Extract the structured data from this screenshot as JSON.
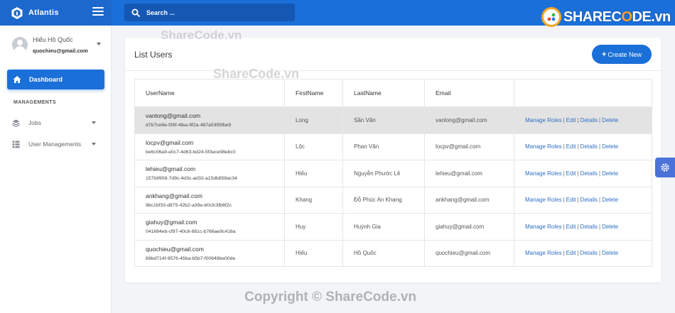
{
  "header": {
    "brand_name": "Atlantis",
    "search_placeholder": "Search ..."
  },
  "watermark": {
    "logo_text_a": "SHAREC",
    "logo_text_o": "O",
    "logo_text_b": "DE.vn",
    "text_1": "ShareCode.vn",
    "text_2": "ShareCode.vn",
    "copyright": "Copyright © ShareCode.vn"
  },
  "sidebar": {
    "user": {
      "name": "Hiếu Hồ Quốc",
      "email": "quochieu@gmail.com"
    },
    "dashboard_label": "Dashboard",
    "section_title": "MANAGEMENTS",
    "items": [
      {
        "label": "Jobs",
        "icon": "layers-icon"
      },
      {
        "label": "User Managements",
        "icon": "table-icon"
      }
    ]
  },
  "main": {
    "title": "List Users",
    "create_button": "Create New",
    "columns": [
      "UserName",
      "FirstName",
      "LastName",
      "Email",
      ""
    ],
    "action_labels": [
      "Manage Roles",
      "Edit",
      "Details",
      "Delete"
    ],
    "rows": [
      {
        "username": "vanlong@gmail.com",
        "id": "d7b7ce9e-f39f-4fea-9f2a-487a5355fbe9",
        "firstname": "Long",
        "lastname": "Sần Văn",
        "email": "vanlong@gmail.com"
      },
      {
        "username": "locpv@gmail.com",
        "id": "be6c06a9-e0c7-4d63-bd24-5f3ece98ebc0",
        "firstname": "Lộc",
        "lastname": "Phan Văn",
        "email": "locpv@gmail.com"
      },
      {
        "username": "lehieu@gmail.com",
        "id": "157b9908-7d9c-4d3c-ad32-a15db858ac34",
        "firstname": "Hiếu",
        "lastname": "Nguyễn Phước Lê",
        "email": "lehieu@gmail.com"
      },
      {
        "username": "ankhang@gmail.com",
        "id": "9bc1bf33-d875-42b2-a39e-b0cfc3fb6f2c",
        "firstname": "Khang",
        "lastname": "Đỗ Phúc An Khang",
        "email": "ankhang@gmail.com"
      },
      {
        "username": "giahuy@gmail.com",
        "id": "041684eb-cf97-40c6-881c-b766ae9c416a",
        "firstname": "Huy",
        "lastname": "Huỳnh Gia",
        "email": "giahuy@gmail.com"
      },
      {
        "username": "quochieu@gmail.com",
        "id": "69bd714f-9576-45ba-b5b7-f00649be00de",
        "firstname": "Hiếu",
        "lastname": "Hồ Quốc",
        "email": "quochieu@gmail.com"
      }
    ]
  },
  "colors": {
    "primary": "#1a6fd8",
    "link": "#2f6fc4",
    "highlight_row": "#e3e3e3"
  }
}
